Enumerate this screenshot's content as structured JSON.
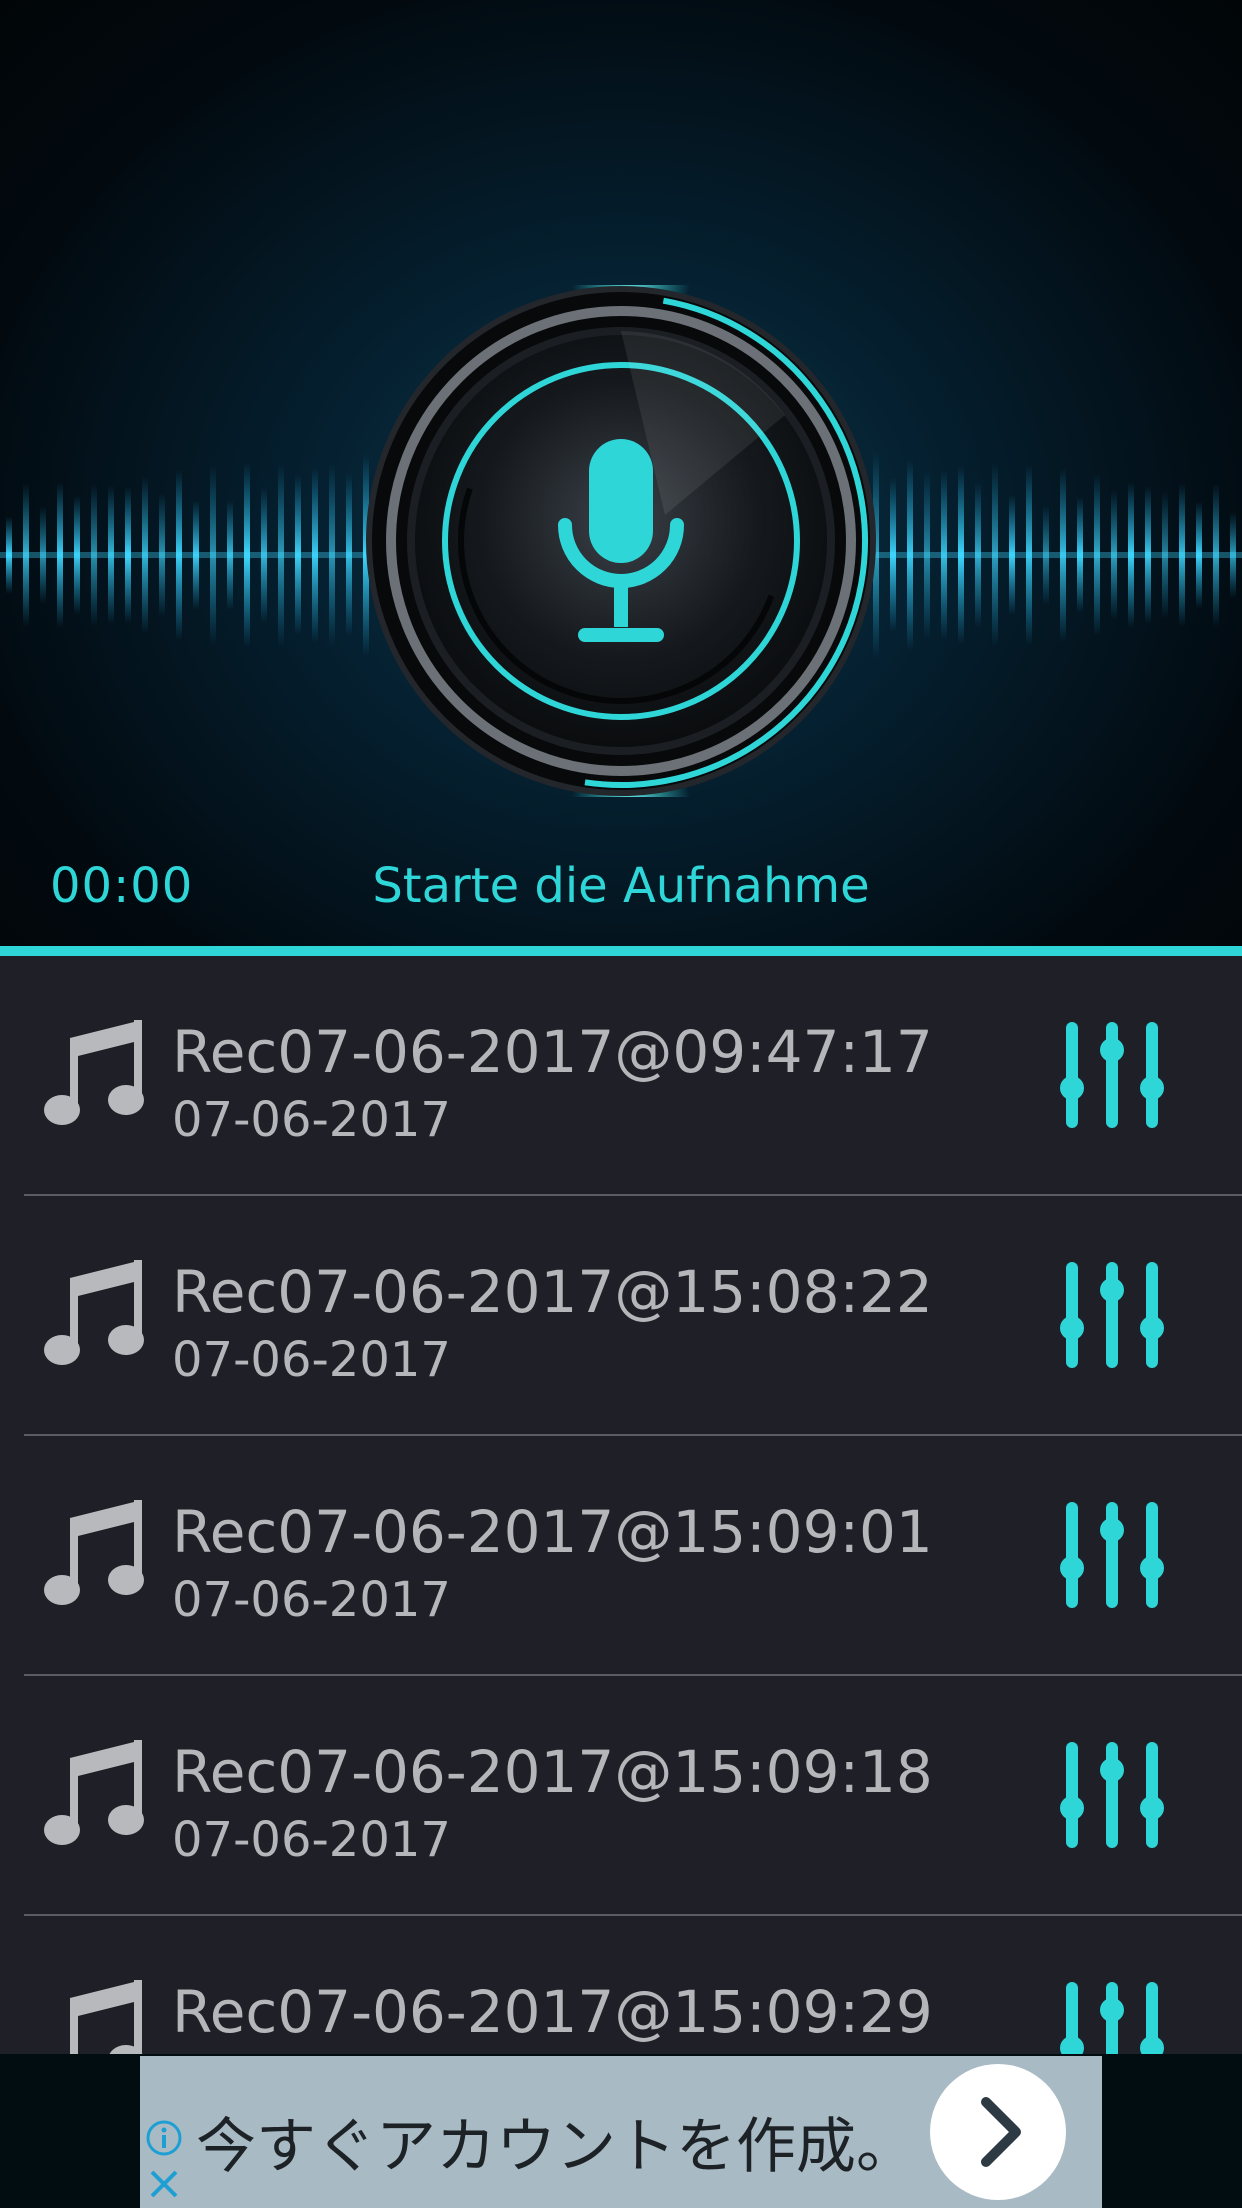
{
  "recorder": {
    "timer": "00:00",
    "status": "Starte die Aufnahme",
    "mic_icon": "microphone-icon",
    "accent_color": "#2fd6d8"
  },
  "recordings": [
    {
      "title": "Rec07-06-2017@09:47:17",
      "date": "07-06-2017",
      "icon": "music-note-icon",
      "action_icon": "equalizer-icon"
    },
    {
      "title": "Rec07-06-2017@15:08:22",
      "date": "07-06-2017",
      "icon": "music-note-icon",
      "action_icon": "equalizer-icon"
    },
    {
      "title": "Rec07-06-2017@15:09:01",
      "date": "07-06-2017",
      "icon": "music-note-icon",
      "action_icon": "equalizer-icon"
    },
    {
      "title": "Rec07-06-2017@15:09:18",
      "date": "07-06-2017",
      "icon": "music-note-icon",
      "action_icon": "equalizer-icon"
    },
    {
      "title": "Rec07-06-2017@15:09:29",
      "date": "",
      "icon": "music-note-icon",
      "action_icon": "equalizer-icon"
    }
  ],
  "ad": {
    "text": "今すぐアカウントを作成。",
    "info_icon": "info-icon",
    "close_icon": "close-icon",
    "cta_icon": "chevron-right-icon"
  }
}
